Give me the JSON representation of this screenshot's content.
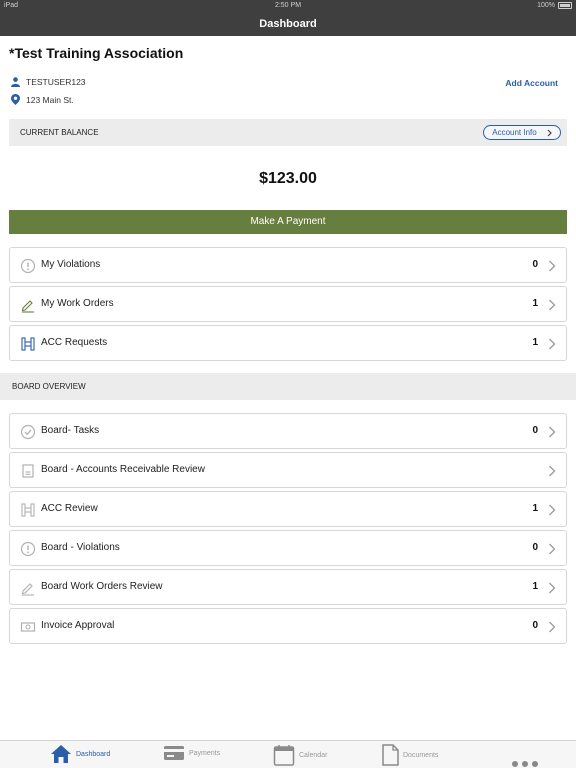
{
  "status_bar": {
    "device": "iPad",
    "time": "2:50 PM",
    "battery": "100%"
  },
  "nav": {
    "title": "Dashboard"
  },
  "account": {
    "name": "*Test Training Association",
    "username": "TESTUSER123",
    "address": "123 Main St.",
    "add_account_label": "Add Account"
  },
  "balance": {
    "label": "CURRENT BALANCE",
    "account_info_label": "Account Info",
    "amount": "$123.00"
  },
  "payment_button": "Make A Payment",
  "my_items": [
    {
      "label": "My Violations",
      "count": "0",
      "icon": "warning-circle-icon"
    },
    {
      "label": "My Work Orders",
      "count": "1",
      "icon": "work-order-icon"
    },
    {
      "label": "ACC Requests",
      "count": "1",
      "icon": "acc-icon"
    }
  ],
  "board_overview": {
    "label": "BOARD OVERVIEW",
    "items": [
      {
        "label": "Board- Tasks",
        "count": "0",
        "icon": "check-circle-icon"
      },
      {
        "label": "Board - Accounts Receivable Review",
        "count": "",
        "icon": "ledger-icon"
      },
      {
        "label": "ACC Review",
        "count": "1",
        "icon": "acc-icon"
      },
      {
        "label": "Board - Violations",
        "count": "0",
        "icon": "warning-circle-icon"
      },
      {
        "label": "Board Work Orders Review",
        "count": "1",
        "icon": "work-order-icon"
      },
      {
        "label": "Invoice Approval",
        "count": "0",
        "icon": "invoice-icon"
      }
    ]
  },
  "tabs": [
    {
      "label": "Dashboard",
      "icon": "home-icon",
      "active": true
    },
    {
      "label": "Payments",
      "icon": "credit-card-icon",
      "active": false
    },
    {
      "label": "Calendar",
      "icon": "calendar-icon",
      "active": false
    },
    {
      "label": "Documents",
      "icon": "document-icon",
      "active": false
    }
  ],
  "colors": {
    "accent": "#2a5ea8",
    "payment_green": "#677f3e",
    "header": "#3f3f3f"
  }
}
